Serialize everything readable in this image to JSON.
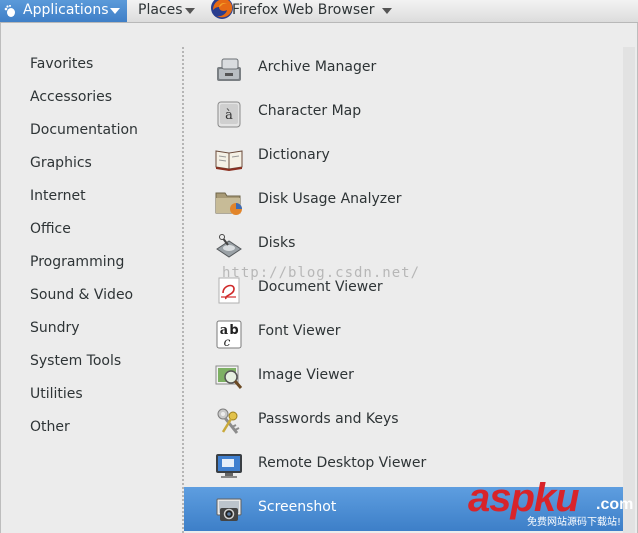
{
  "top_panel": {
    "applications_label": "Applications",
    "places_label": "Places",
    "browser_label": "Firefox Web Browser"
  },
  "categories": [
    "Favorites",
    "Accessories",
    "Documentation",
    "Graphics",
    "Internet",
    "Office",
    "Programming",
    "Sound & Video",
    "Sundry",
    "System Tools",
    "Utilities",
    "Other"
  ],
  "apps": [
    {
      "label": "Archive Manager",
      "icon": "archive-manager-icon"
    },
    {
      "label": "Character Map",
      "icon": "character-map-icon"
    },
    {
      "label": "Dictionary",
      "icon": "dictionary-icon"
    },
    {
      "label": "Disk Usage Analyzer",
      "icon": "disk-usage-analyzer-icon"
    },
    {
      "label": "Disks",
      "icon": "disks-icon"
    },
    {
      "label": "Document Viewer",
      "icon": "document-viewer-icon"
    },
    {
      "label": "Font Viewer",
      "icon": "font-viewer-icon"
    },
    {
      "label": "Image Viewer",
      "icon": "image-viewer-icon"
    },
    {
      "label": "Passwords and Keys",
      "icon": "passwords-and-keys-icon"
    },
    {
      "label": "Remote Desktop Viewer",
      "icon": "remote-desktop-viewer-icon"
    },
    {
      "label": "Screenshot",
      "icon": "screenshot-icon",
      "selected": true
    }
  ],
  "watermark": {
    "url_text": "http://blog.csdn.net/",
    "logo_text": "aspku",
    "logo_suffix": ".com",
    "logo_tagline": "免费网站源码下载站!"
  },
  "colors": {
    "selection": "#4a8bd4",
    "panel_bg": "#ececec",
    "logo_red": "#d8242a"
  }
}
